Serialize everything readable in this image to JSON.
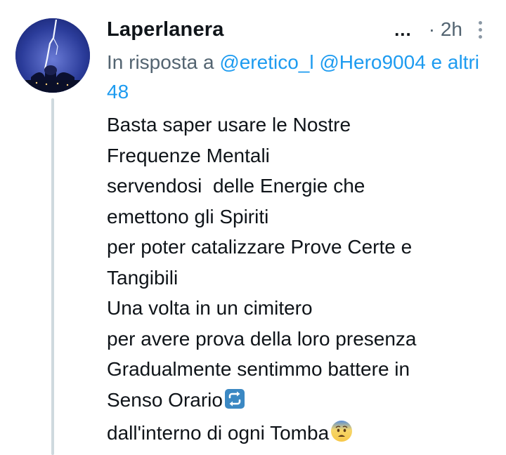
{
  "tweet": {
    "display_name": "Laperlanera",
    "time_dots": "...",
    "time": "· 2h",
    "reply_prefix": "In risposta a",
    "mentions": [
      "@eretico_l",
      "@Hero9004"
    ],
    "others": "e altri 48",
    "lines": [
      "Basta saper usare le Nostre",
      "Frequenze Mentali",
      "servendosi  delle Energie che",
      "emettono gli Spiriti",
      "per poter catalizzare Prove Certe e",
      "Tangibili",
      "Una volta in un cimitero",
      "per avere prova della loro presenza",
      "Gradualmente sentimmo battere in",
      "Senso Orario",
      "dall'interno di ogni Tomba"
    ],
    "emoji_repeat": "repeat-button-emoji",
    "emoji_fear": "fearful-face-emoji"
  },
  "colors": {
    "link": "#1d9bf0",
    "muted": "#536471",
    "text": "#0f1419",
    "thread": "#cfd9de"
  }
}
